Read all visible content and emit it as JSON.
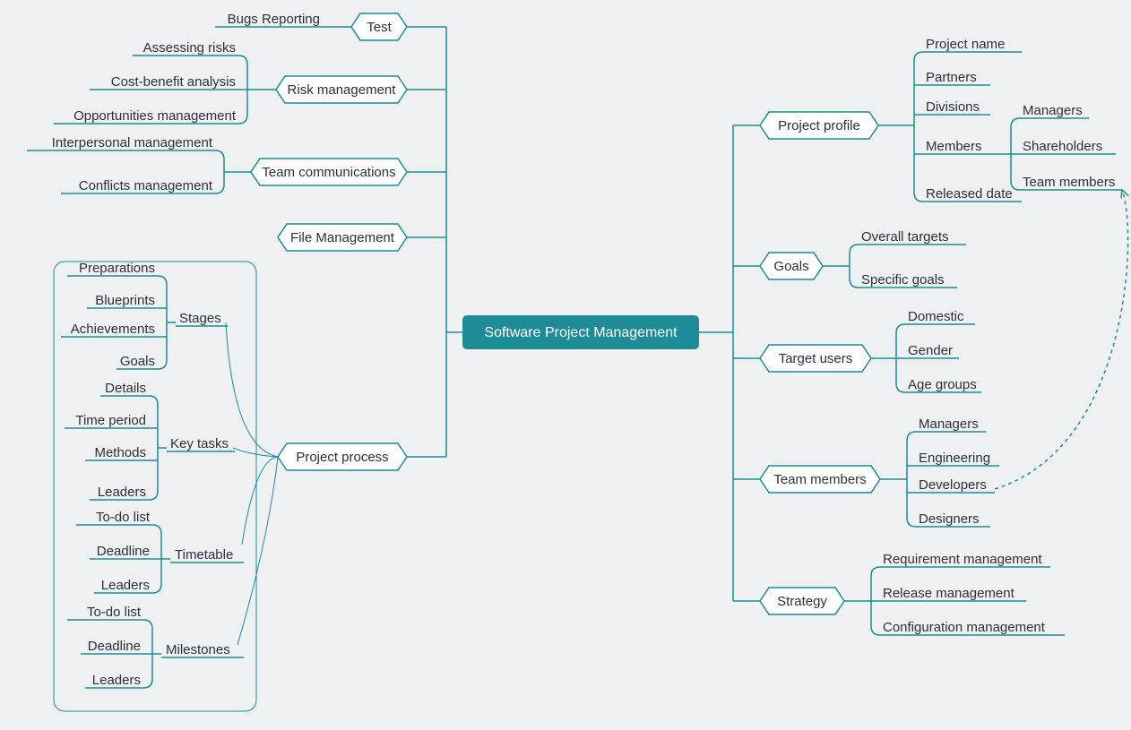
{
  "central": "Software Project Management",
  "right": {
    "projectProfile": {
      "label": "Project profile",
      "children": [
        "Project name",
        "Partners",
        "Divisions",
        "Members",
        "Released date"
      ],
      "members": {
        "label": "Members",
        "children": [
          "Managers",
          "Shareholders",
          "Team members"
        ]
      }
    },
    "goals": {
      "label": "Goals",
      "children": [
        "Overall targets",
        "Specific goals"
      ]
    },
    "targetUsers": {
      "label": "Target users",
      "children": [
        "Domestic",
        "Gender",
        "Age groups"
      ]
    },
    "teamMembers": {
      "label": "Team members",
      "children": [
        "Managers",
        "Engineering",
        "Developers",
        "Designers"
      ]
    },
    "strategy": {
      "label": "Strategy",
      "children": [
        "Requirement management",
        "Release management",
        "Configuration management"
      ]
    }
  },
  "left": {
    "test": {
      "label": "Test",
      "children": [
        "Bugs Reporting"
      ]
    },
    "risk": {
      "label": "Risk management",
      "children": [
        "Assessing risks",
        "Cost-benefit analysis",
        "Opportunities management"
      ]
    },
    "teamComm": {
      "label": "Team communications",
      "children": [
        "Interpersonal management",
        "Conflicts management"
      ]
    },
    "fileMgmt": {
      "label": "File Management",
      "children": []
    },
    "process": {
      "label": "Project process",
      "groups": {
        "stages": {
          "label": "Stages",
          "children": [
            "Preparations",
            "Blueprints",
            "Achievements",
            "Goals"
          ]
        },
        "keytasks": {
          "label": "Key tasks",
          "children": [
            "Details",
            "Time period",
            "Methods",
            "Leaders"
          ]
        },
        "timetable": {
          "label": "Timetable",
          "children": [
            "To-do list",
            "Deadline",
            "Leaders"
          ]
        },
        "milestones": {
          "label": "Milestones",
          "children": [
            "To-do list",
            "Deadline",
            "Leaders"
          ]
        }
      }
    }
  }
}
